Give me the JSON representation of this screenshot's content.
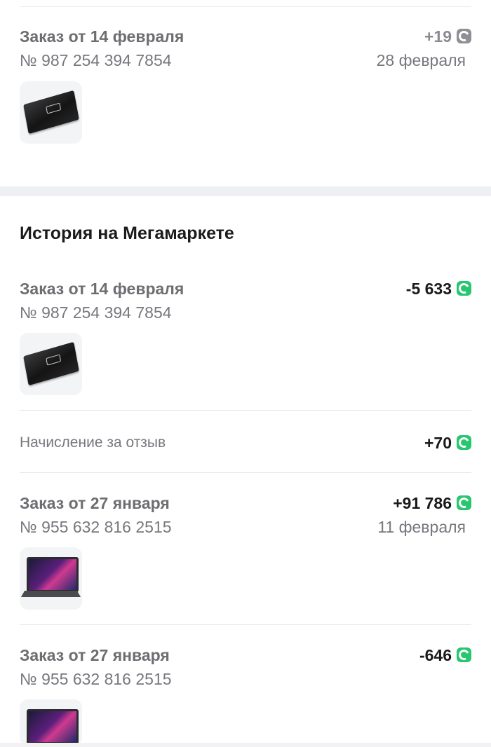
{
  "top_order": {
    "title": "Заказ от 14 февраля",
    "number": "№ 987 254 394 7854",
    "amount": "+19",
    "date": "28 февраля",
    "coin_color": "#8e9096",
    "product_icon": "ssd-image"
  },
  "history": {
    "title": "История на Мегамаркете",
    "items": [
      {
        "title": "Заказ от 14 февраля",
        "number": "№ 987 254 394 7854",
        "amount": "-5 633",
        "coin_color": "#28c76f",
        "product_icon": "ssd-image"
      },
      {
        "label": "Начисление за отзыв",
        "amount": "+70",
        "coin_color": "#28c76f"
      },
      {
        "title": "Заказ от 27 января",
        "number": "№ 955 632 816 2515",
        "amount": "+91 786",
        "date": "11 февраля",
        "coin_color": "#28c76f",
        "product_icon": "laptop-image"
      },
      {
        "title": "Заказ от 27 января",
        "number": "№ 955 632 816 2515",
        "amount": "-646",
        "coin_color": "#28c76f",
        "product_icon": "laptop-image"
      }
    ]
  }
}
